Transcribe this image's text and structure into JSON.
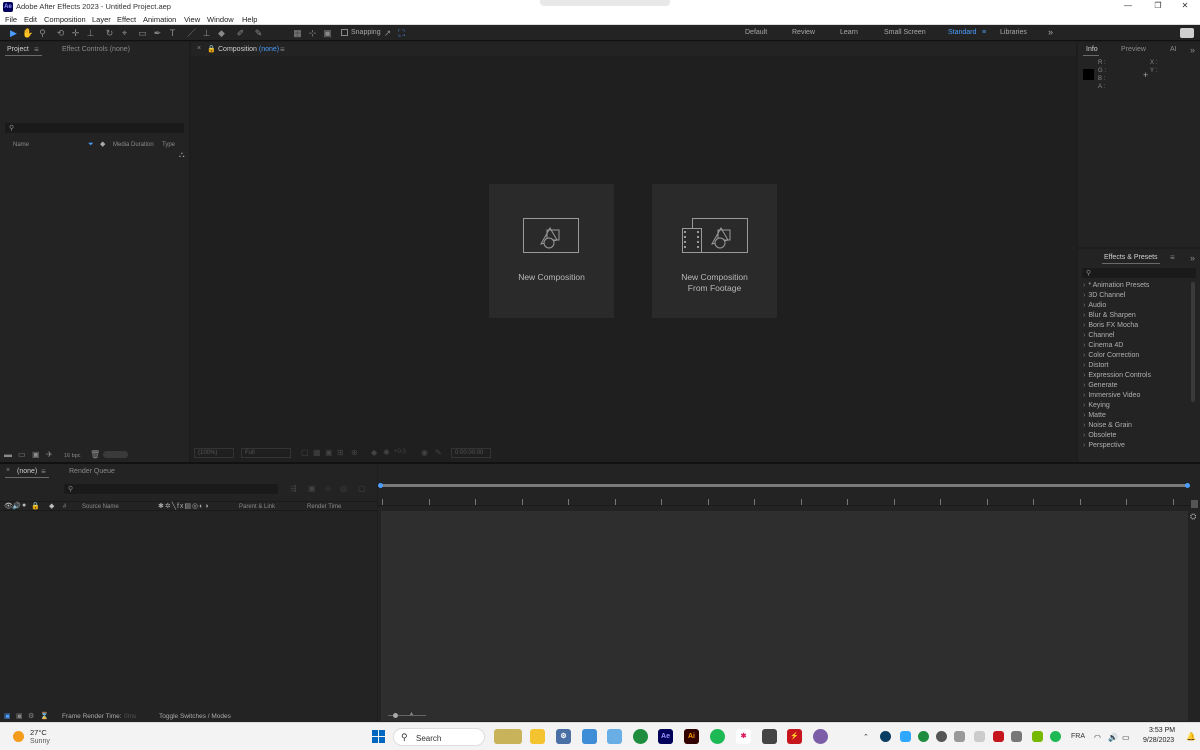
{
  "window": {
    "title": "Adobe After Effects 2023 - Untitled Project.aep",
    "app_icon": "Ae",
    "controls": [
      "—",
      "❐",
      "✕"
    ]
  },
  "menu": [
    "File",
    "Edit",
    "Composition",
    "Layer",
    "Effect",
    "Animation",
    "View",
    "Window",
    "Help"
  ],
  "toolbar": {
    "snapping_label": "Snapping",
    "workspaces": [
      "Default",
      "Review",
      "Learn",
      "Small Screen",
      "Standard",
      "Libraries"
    ],
    "active_workspace": "Standard",
    "accent_color": "#4a9eff"
  },
  "project_panel": {
    "tabs": [
      "Project",
      "Effect Controls (none)"
    ],
    "columns": [
      "Name",
      "Media Duration",
      "Type"
    ],
    "bpc_label": "16 bpc"
  },
  "composition_panel": {
    "tab_label": "Composition",
    "tab_value": "(none)",
    "cards": [
      {
        "line1": "New Composition",
        "line2": ""
      },
      {
        "line1": "New Composition",
        "line2": "From Footage"
      }
    ],
    "footer": {
      "zoom": "(100%)",
      "resolution": "Full",
      "exposure": "+0.0",
      "timecode": "0:00:00:00"
    }
  },
  "info_panel": {
    "tabs": [
      "Info",
      "Preview",
      "AI"
    ],
    "channels": [
      "R :",
      "G :",
      "B :",
      "A :"
    ],
    "coords": [
      "X :",
      "Y :"
    ]
  },
  "effects_panel": {
    "title": "Effects & Presets",
    "items": [
      "* Animation Presets",
      "3D Channel",
      "Audio",
      "Blur & Sharpen",
      "Boris FX Mocha",
      "Channel",
      "Cinema 4D",
      "Color Correction",
      "Distort",
      "Expression Controls",
      "Generate",
      "Immersive Video",
      "Keying",
      "Matte",
      "Noise & Grain",
      "Obsolete",
      "Perspective"
    ]
  },
  "timeline_panel": {
    "tabs": [
      "(none)",
      "Render Queue"
    ],
    "columns": [
      "#",
      "Source Name",
      "Parent & Link",
      "Render Time"
    ],
    "footer_render_label": "Frame Render Time:",
    "footer_render_value": "0ms",
    "footer_toggle": "Toggle Switches / Modes"
  },
  "taskbar": {
    "weather_temp": "27°C",
    "weather_desc": "Sunny",
    "search_label": "Search",
    "language": "FRA",
    "time": "3:53 PM",
    "date": "9/28/2023"
  }
}
